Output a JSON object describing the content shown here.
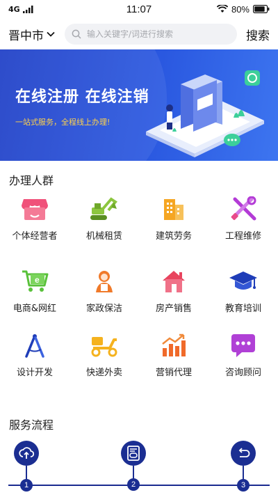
{
  "status_bar": {
    "network": "4G",
    "time": "11:07",
    "battery": "80%"
  },
  "header": {
    "city": "晋中市",
    "search_placeholder": "输入关键字/词进行搜索",
    "search_button": "搜索"
  },
  "banner": {
    "title": "在线注册  在线注销",
    "subtitle": "一站式服务，全程线上办理!"
  },
  "groups": {
    "title": "办理人群",
    "items": [
      {
        "label": "个体经营者",
        "icon": "shop-icon",
        "color": "#f0517a"
      },
      {
        "label": "机械租赁",
        "icon": "excavator-icon",
        "color": "#8cc63f"
      },
      {
        "label": "建筑劳务",
        "icon": "building-icon",
        "color": "#f5a623"
      },
      {
        "label": "工程维修",
        "icon": "tools-icon",
        "color": "#b33bd6"
      },
      {
        "label": "电商&网红",
        "icon": "cart-icon",
        "color": "#59c13a"
      },
      {
        "label": "家政保洁",
        "icon": "housekeeper-icon",
        "color": "#f07a2a"
      },
      {
        "label": "房产销售",
        "icon": "house-icon",
        "color": "#e8445e"
      },
      {
        "label": "教育培训",
        "icon": "graduation-cap-icon",
        "color": "#1f3db8"
      },
      {
        "label": "设计开发",
        "icon": "compass-icon",
        "color": "#1f3db8"
      },
      {
        "label": "快递外卖",
        "icon": "scooter-icon",
        "color": "#f5b21e"
      },
      {
        "label": "营销代理",
        "icon": "growth-chart-icon",
        "color": "#f06a2a"
      },
      {
        "label": "咨询顾问",
        "icon": "chat-bubble-icon",
        "color": "#b040d6"
      }
    ]
  },
  "process": {
    "title": "服务流程",
    "steps": [
      {
        "num": "1",
        "icon": "cloud-upload-icon"
      },
      {
        "num": "2",
        "icon": "id-card-icon"
      },
      {
        "num": "3",
        "icon": "return-icon"
      }
    ]
  }
}
